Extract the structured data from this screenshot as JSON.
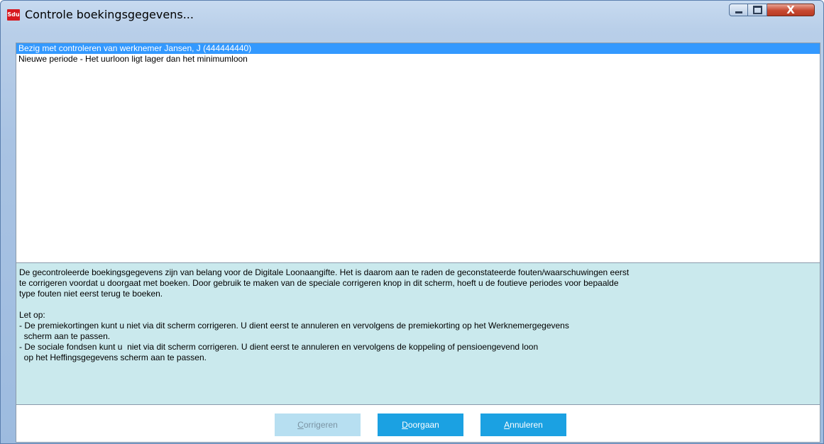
{
  "window": {
    "title": "Controle boekingsgegevens...",
    "icon_text": "Sdu",
    "controls": {
      "minimize": "minimize-icon",
      "maximize": "maximize-icon",
      "close": "X"
    }
  },
  "messages": [
    {
      "text": "Bezig met controleren van werknemer Jansen, J (444444440)",
      "selected": true
    },
    {
      "text": "Nieuwe periode - Het uurloon ligt lager dan het minimumloon",
      "selected": false
    }
  ],
  "info": {
    "para1": "De gecontroleerde boekingsgegevens zijn van belang voor de Digitale Loonaangifte. Het is daarom aan te raden de geconstateerde fouten/waarschuwingen eerst\nte corrigeren voordat u doorgaat met boeken. Door gebruik te maken van de speciale corrigeren knop in dit scherm, hoeft u de foutieve periodes voor bepaalde\ntype fouten niet eerst terug te boeken.",
    "note_heading": "Let op:",
    "note1": "- De premiekortingen kunt u niet via dit scherm corrigeren. U dient eerst te annuleren en vervolgens de premiekorting op het Werknemergegevens\n  scherm aan te passen.",
    "note2": "- De sociale fondsen kunt u  niet via dit scherm corrigeren. U dient eerst te annuleren en vervolgens de koppeling of pensioengevend loon\n  op het Heffingsgegevens scherm aan te passen."
  },
  "buttons": {
    "corrigeren": {
      "accel": "C",
      "rest": "orrigeren",
      "enabled": false
    },
    "doorgaan": {
      "accel": "D",
      "rest": "oorgaan",
      "enabled": true
    },
    "annuleren": {
      "accel": "A",
      "rest": "nnuleren",
      "enabled": true
    }
  },
  "colors": {
    "accent": "#1ba1e2",
    "selection": "#3399ff",
    "info_background": "#cae9ed",
    "close_button": "#c74a32"
  }
}
